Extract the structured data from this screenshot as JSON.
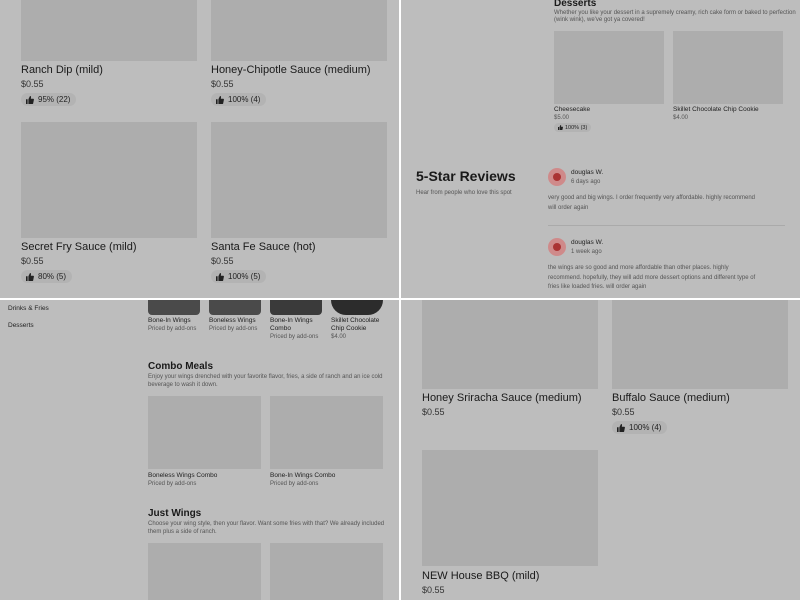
{
  "top_left": {
    "items": [
      {
        "name": "Ranch Dip (mild)",
        "price": "$0.55",
        "rating": "95% (22)"
      },
      {
        "name": "Honey-Chipotle Sauce (medium)",
        "price": "$0.55",
        "rating": "100% (4)"
      },
      {
        "name": "Secret Fry Sauce (mild)",
        "price": "$0.55",
        "rating": "80% (5)"
      },
      {
        "name": "Santa Fe Sauce (hot)",
        "price": "$0.55",
        "rating": "100% (5)"
      }
    ]
  },
  "top_right": {
    "desserts": {
      "title": "Desserts",
      "description_line1": "Whether you like your dessert in a supremely creamy, rich cake form or baked to perfection",
      "description_line2": "(wink wink), we've got ya covered!",
      "items": [
        {
          "name": "Cheesecake",
          "price": "$5.00",
          "rating": "100% (3)"
        },
        {
          "name": "Skillet Chocolate Chip Cookie",
          "price": "$4.00"
        }
      ]
    },
    "reviews": {
      "title": "5-Star Reviews",
      "subtitle": "Hear from people who love this spot",
      "entries": [
        {
          "author": "douglas W.",
          "when": "6 days ago",
          "line1": "very good and big wings. I order frequently very affordable. highly recommend",
          "line2": "will order again"
        },
        {
          "author": "douglas W.",
          "when": "1 week ago",
          "line1": "the wings are so good and more affordable than other places. highly",
          "line2": "recommend. hopefully, they will add more dessert options and different type of",
          "line3": "fries like loaded fries. will order again"
        }
      ]
    }
  },
  "bottom_left": {
    "nav": [
      "Drinks & Fries",
      "Desserts"
    ],
    "featured": [
      {
        "name": "Bone-In Wings",
        "price": "Priced by add-ons"
      },
      {
        "name": "Boneless Wings",
        "price": "Priced by add-ons"
      },
      {
        "name_line1": "Bone-In Wings",
        "name_line2": "Combo",
        "price": "Priced by add-ons"
      },
      {
        "name_line1": "Skillet Chocolate",
        "name_line2": "Chip Cookie",
        "price": "$4.00"
      }
    ],
    "combo": {
      "title": "Combo Meals",
      "description_line1": "Enjoy your wings drenched with your favorite flavor, fries, a side of ranch and an ice cold",
      "description_line2": "beverage to wash it down.",
      "items": [
        {
          "name": "Boneless Wings Combo",
          "price": "Priced by add-ons"
        },
        {
          "name": "Bone-In Wings Combo",
          "price": "Priced by add-ons"
        }
      ]
    },
    "just_wings": {
      "title": "Just Wings",
      "description_line1": "Choose your wing style, then your flavor. Want some fries with that? We already included",
      "description_line2": "them plus a side of ranch."
    }
  },
  "bottom_right": {
    "items": [
      {
        "name": "Honey Sriracha Sauce (medium)",
        "price": "$0.55"
      },
      {
        "name": "Buffalo Sauce (medium)",
        "price": "$0.55",
        "rating": "100% (4)"
      },
      {
        "name": "NEW House BBQ (mild)",
        "price": "$0.55"
      }
    ]
  },
  "icons": {
    "rating": "thumbs-up-icon",
    "avatar": "tomato-avatar-icon"
  },
  "colors": {
    "background": "#bdbdbd",
    "placeholder": "#adadad",
    "divider": "#ffffff",
    "avatar": "#cf8a8a"
  }
}
